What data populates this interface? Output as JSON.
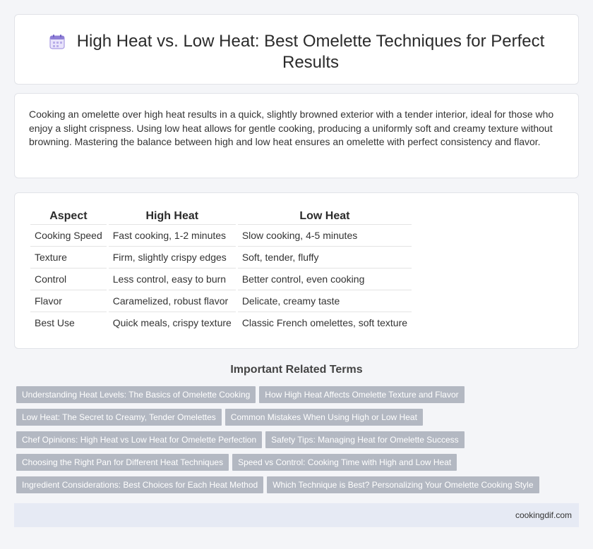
{
  "header": {
    "title": "High Heat vs. Low Heat: Best Omelette Techniques for Perfect Results",
    "icon": "calendar-icon"
  },
  "intro": {
    "text": "Cooking an omelette over high heat results in a quick, slightly browned exterior with a tender interior, ideal for those who enjoy a slight crispness. Using low heat allows for gentle cooking, producing a uniformly soft and creamy texture without browning. Mastering the balance between high and low heat ensures an omelette with perfect consistency and flavor."
  },
  "table": {
    "headers": [
      "Aspect",
      "High Heat",
      "Low Heat"
    ],
    "rows": [
      [
        "Cooking Speed",
        "Fast cooking, 1-2 minutes",
        "Slow cooking, 4-5 minutes"
      ],
      [
        "Texture",
        "Firm, slightly crispy edges",
        "Soft, tender, fluffy"
      ],
      [
        "Control",
        "Less control, easy to burn",
        "Better control, even cooking"
      ],
      [
        "Flavor",
        "Caramelized, robust flavor",
        "Delicate, creamy taste"
      ],
      [
        "Best Use",
        "Quick meals, crispy texture",
        "Classic French omelettes, soft texture"
      ]
    ]
  },
  "related": {
    "heading": "Important Related Terms",
    "rows": [
      [
        "Understanding Heat Levels: The Basics of Omelette Cooking",
        "How High Heat Affects Omelette Texture and Flavor"
      ],
      [
        "Low Heat: The Secret to Creamy, Tender Omelettes",
        "Common Mistakes When Using High or Low Heat"
      ],
      [
        "Chef Opinions: High Heat vs Low Heat for Omelette Perfection",
        "Safety Tips: Managing Heat for Omelette Success"
      ],
      [
        "Choosing the Right Pan for Different Heat Techniques",
        "Speed vs Control: Cooking Time with High and Low Heat"
      ],
      [
        "Ingredient Considerations: Best Choices for Each Heat Method",
        "Which Technique is Best? Personalizing Your Omelette Cooking Style"
      ]
    ]
  },
  "footer": {
    "site": "cookingdif.com"
  },
  "colors": {
    "background": "#f4f5f8",
    "tag_bg": "#b3b8c2",
    "footer_bg": "#e6eaf4",
    "icon_accent": "#8f7fd6"
  }
}
